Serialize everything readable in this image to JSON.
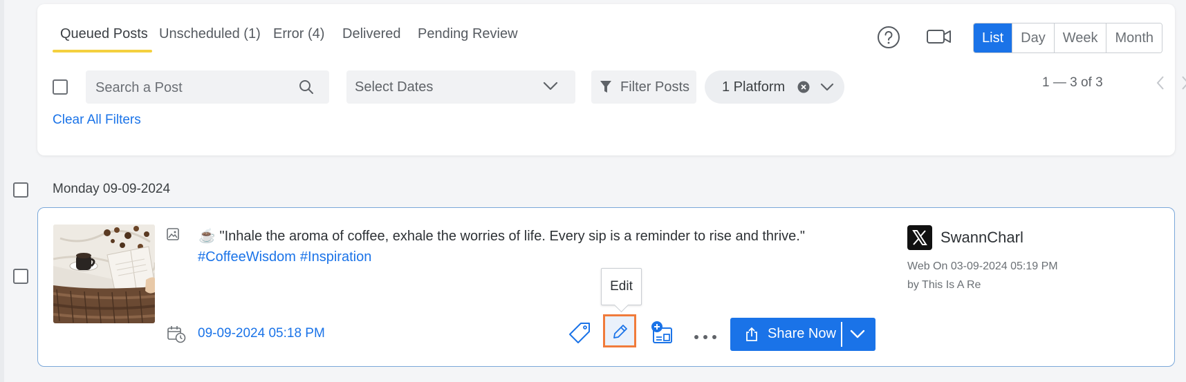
{
  "tabs": [
    {
      "label": "Queued Posts",
      "active": true
    },
    {
      "label": "Unscheduled (1)",
      "active": false
    },
    {
      "label": "Error (4)",
      "active": false
    },
    {
      "label": "Delivered",
      "active": false
    },
    {
      "label": "Pending Review",
      "active": false
    }
  ],
  "header_icons": [
    "help-circle-icon",
    "video-camera-icon"
  ],
  "view_options": [
    "List",
    "Day",
    "Week",
    "Month"
  ],
  "active_view": "List",
  "toolbar": {
    "search_placeholder": "Search a Post",
    "dates_label": "Select Dates",
    "filter_label": "Filter Posts",
    "platform_label": "1 Platform",
    "pagination": "1 — 3 of 3",
    "clear_filters": "Clear All Filters"
  },
  "group": {
    "date_label": "Monday 09-09-2024"
  },
  "post": {
    "emoji": "☕",
    "text": "\"Inhale the aroma of coffee, exhale the worries of life. Every sip is a reminder to rise and thrive.\"",
    "hashtags": [
      "#CoffeeWisdom",
      "#Inspiration"
    ],
    "scheduled_time": "09-09-2024 05:18 PM",
    "tooltip": "Edit",
    "share_label": "Share Now",
    "account": {
      "name": "SwannCharl",
      "platform_icon": "x-logo-icon",
      "meta_line1": "Web On 03-09-2024 05:19 PM",
      "meta_line2": "by This Is A Re"
    }
  },
  "colors": {
    "accent": "#1a73e8",
    "tab_underline": "#f4d03f",
    "edit_highlight": "#f07b3b",
    "card_border": "#7aa7d9"
  }
}
